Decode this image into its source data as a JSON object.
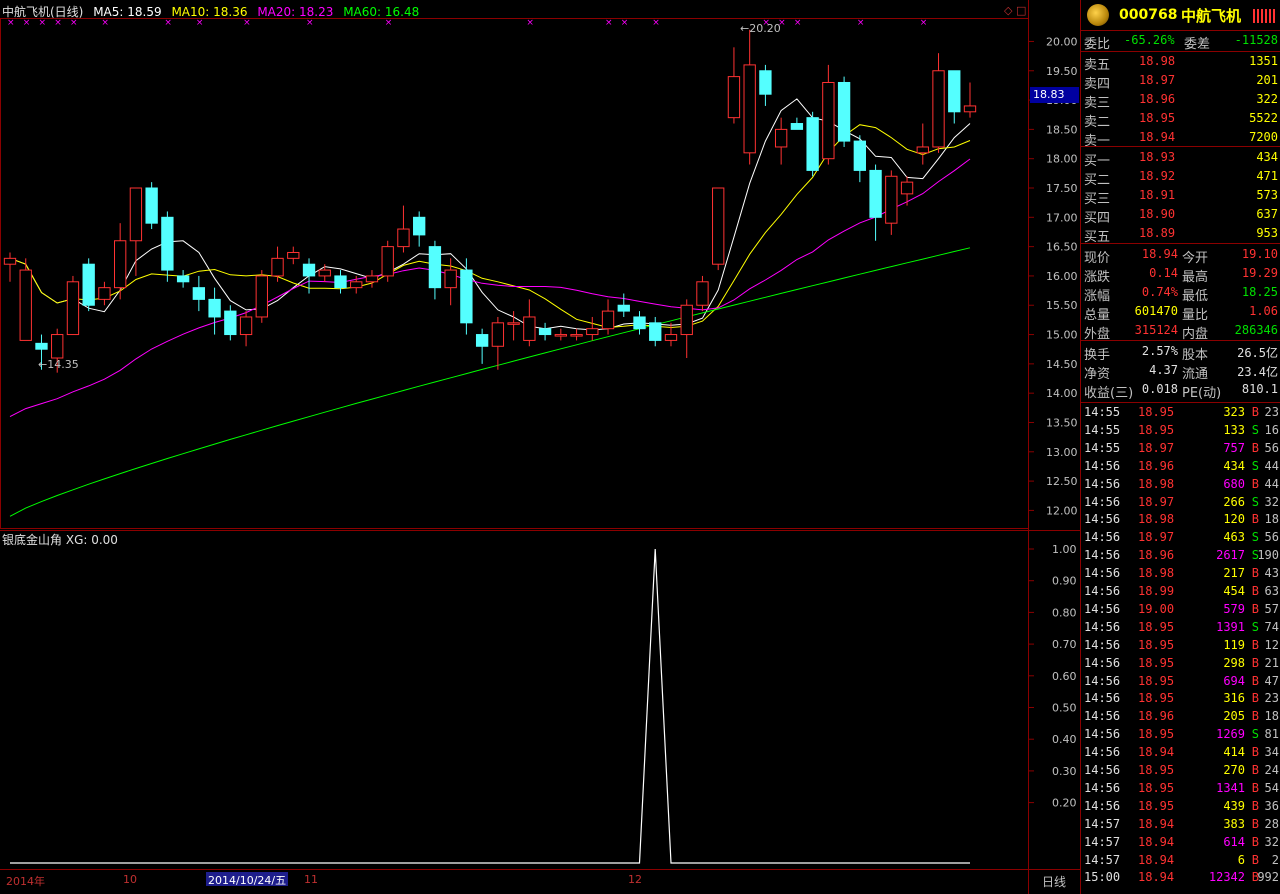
{
  "header": {
    "title": "中航飞机(日线)",
    "ma5": "MA5: 18.59",
    "ma10": "MA10: 18.36",
    "ma20": "MA20: 18.23",
    "ma60": "MA60: 16.48"
  },
  "price_axis": [
    "20.00",
    "19.50",
    "19.00",
    "18.50",
    "18.00",
    "17.50",
    "17.00",
    "16.50",
    "16.00",
    "15.50",
    "15.00",
    "14.50",
    "14.00",
    "13.50",
    "13.00",
    "12.50",
    "12.00"
  ],
  "current_price_tag": "18.83",
  "annotations": {
    "high": "20.20",
    "low": "14.35"
  },
  "indicator": {
    "title": "银底金山角",
    "xg": "XG: 0.00",
    "axis": [
      "1.00",
      "0.90",
      "0.80",
      "0.70",
      "0.60",
      "0.50",
      "0.40",
      "0.30",
      "0.20"
    ]
  },
  "time_axis": {
    "year": "2014年",
    "m10": "10",
    "cursor_date": "2014/10/24/五",
    "m11": "11",
    "m12": "12",
    "period": "日线"
  },
  "quote": {
    "code": "000768",
    "name": "中航飞机",
    "wb_label": "委比",
    "wb_value": "-65.26%",
    "wc_label": "委差",
    "wc_value": "-11528",
    "asks": [
      {
        "label": "卖五",
        "price": "18.98",
        "vol": "1351"
      },
      {
        "label": "卖四",
        "price": "18.97",
        "vol": "201"
      },
      {
        "label": "卖三",
        "price": "18.96",
        "vol": "322"
      },
      {
        "label": "卖二",
        "price": "18.95",
        "vol": "5522"
      },
      {
        "label": "卖一",
        "price": "18.94",
        "vol": "7200"
      }
    ],
    "bids": [
      {
        "label": "买一",
        "price": "18.93",
        "vol": "434"
      },
      {
        "label": "买二",
        "price": "18.92",
        "vol": "471"
      },
      {
        "label": "买三",
        "price": "18.91",
        "vol": "573"
      },
      {
        "label": "买四",
        "price": "18.90",
        "vol": "637"
      },
      {
        "label": "买五",
        "price": "18.89",
        "vol": "953"
      }
    ],
    "stats": [
      {
        "l1": "现价",
        "v1": "18.94",
        "l2": "今开",
        "v2": "19.10"
      },
      {
        "l1": "涨跌",
        "v1": "0.14",
        "l2": "最高",
        "v2": "19.29"
      },
      {
        "l1": "涨幅",
        "v1": "0.74%",
        "l2": "最低",
        "v2": "18.25"
      },
      {
        "l1": "总量",
        "v1": "601470",
        "l2": "量比",
        "v2": "1.06"
      },
      {
        "l1": "外盘",
        "v1": "315124",
        "l2": "内盘",
        "v2": "286346"
      }
    ],
    "fundamentals": [
      {
        "l1": "换手",
        "v1": "2.57%",
        "l2": "股本",
        "v2": "26.5亿"
      },
      {
        "l1": "净资",
        "v1": "4.37",
        "l2": "流通",
        "v2": "23.4亿"
      },
      {
        "l1": "收益(三)",
        "v1": "0.018",
        "l2": "PE(动)",
        "v2": "810.1"
      }
    ]
  },
  "ticks": [
    {
      "t": "14:55",
      "p": "18.95",
      "v": "323",
      "s": "B",
      "n": "23"
    },
    {
      "t": "14:55",
      "p": "18.95",
      "v": "133",
      "s": "S",
      "n": "16"
    },
    {
      "t": "14:55",
      "p": "18.97",
      "v": "757",
      "s": "B",
      "n": "56"
    },
    {
      "t": "14:56",
      "p": "18.96",
      "v": "434",
      "s": "S",
      "n": "44"
    },
    {
      "t": "14:56",
      "p": "18.98",
      "v": "680",
      "s": "B",
      "n": "44"
    },
    {
      "t": "14:56",
      "p": "18.97",
      "v": "266",
      "s": "S",
      "n": "32"
    },
    {
      "t": "14:56",
      "p": "18.98",
      "v": "120",
      "s": "B",
      "n": "18"
    },
    {
      "t": "14:56",
      "p": "18.97",
      "v": "463",
      "s": "S",
      "n": "56"
    },
    {
      "t": "14:56",
      "p": "18.96",
      "v": "2617",
      "s": "S",
      "n": "190"
    },
    {
      "t": "14:56",
      "p": "18.98",
      "v": "217",
      "s": "B",
      "n": "43"
    },
    {
      "t": "14:56",
      "p": "18.99",
      "v": "454",
      "s": "B",
      "n": "63"
    },
    {
      "t": "14:56",
      "p": "19.00",
      "v": "579",
      "s": "B",
      "n": "57"
    },
    {
      "t": "14:56",
      "p": "18.95",
      "v": "1391",
      "s": "S",
      "n": "74"
    },
    {
      "t": "14:56",
      "p": "18.95",
      "v": "119",
      "s": "B",
      "n": "12"
    },
    {
      "t": "14:56",
      "p": "18.95",
      "v": "298",
      "s": "B",
      "n": "21"
    },
    {
      "t": "14:56",
      "p": "18.95",
      "v": "694",
      "s": "B",
      "n": "47"
    },
    {
      "t": "14:56",
      "p": "18.95",
      "v": "316",
      "s": "B",
      "n": "23"
    },
    {
      "t": "14:56",
      "p": "18.96",
      "v": "205",
      "s": "B",
      "n": "18"
    },
    {
      "t": "14:56",
      "p": "18.95",
      "v": "1269",
      "s": "S",
      "n": "81"
    },
    {
      "t": "14:56",
      "p": "18.94",
      "v": "414",
      "s": "B",
      "n": "34"
    },
    {
      "t": "14:56",
      "p": "18.95",
      "v": "270",
      "s": "B",
      "n": "24"
    },
    {
      "t": "14:56",
      "p": "18.95",
      "v": "1341",
      "s": "B",
      "n": "54"
    },
    {
      "t": "14:56",
      "p": "18.95",
      "v": "439",
      "s": "B",
      "n": "36"
    },
    {
      "t": "14:57",
      "p": "18.94",
      "v": "383",
      "s": "B",
      "n": "28"
    },
    {
      "t": "14:57",
      "p": "18.94",
      "v": "614",
      "s": "B",
      "n": "32"
    },
    {
      "t": "14:57",
      "p": "18.94",
      "v": "6",
      "s": "B",
      "n": "2"
    },
    {
      "t": "15:00",
      "p": "18.94",
      "v": "12342",
      "s": "B",
      "n": "992"
    }
  ],
  "chart_data": {
    "type": "candlestick",
    "ylim": [
      11.7,
      20.4
    ],
    "candles": [
      [
        16.2,
        16.3,
        16.4,
        15.9
      ],
      [
        14.9,
        16.1,
        16.3,
        14.9
      ],
      [
        14.85,
        14.75,
        15.0,
        14.4
      ],
      [
        14.6,
        15.0,
        15.1,
        14.35
      ],
      [
        15.0,
        15.9,
        16.0,
        15.0
      ],
      [
        16.2,
        15.5,
        16.3,
        15.4
      ],
      [
        15.6,
        15.8,
        15.9,
        15.5
      ],
      [
        15.8,
        16.6,
        16.9,
        15.6
      ],
      [
        16.6,
        17.5,
        17.5,
        16.0
      ],
      [
        17.5,
        16.9,
        17.6,
        16.8
      ],
      [
        17.0,
        16.1,
        17.1,
        15.9
      ],
      [
        16.0,
        15.9,
        16.1,
        15.8
      ],
      [
        15.8,
        15.6,
        16.0,
        15.4
      ],
      [
        15.6,
        15.3,
        15.8,
        15.0
      ],
      [
        15.4,
        15.0,
        15.5,
        14.9
      ],
      [
        15.0,
        15.3,
        15.4,
        14.8
      ],
      [
        15.3,
        16.0,
        16.1,
        15.2
      ],
      [
        16.0,
        16.3,
        16.5,
        15.9
      ],
      [
        16.3,
        16.4,
        16.5,
        16.2
      ],
      [
        16.2,
        16.0,
        16.3,
        15.7
      ],
      [
        16.0,
        16.1,
        16.2,
        15.9
      ],
      [
        16.0,
        15.8,
        16.1,
        15.7
      ],
      [
        15.8,
        15.9,
        16.0,
        15.7
      ],
      [
        15.9,
        16.0,
        16.1,
        15.8
      ],
      [
        16.0,
        16.5,
        16.6,
        15.9
      ],
      [
        16.5,
        16.8,
        17.2,
        16.4
      ],
      [
        17.0,
        16.7,
        17.1,
        16.5
      ],
      [
        16.5,
        15.8,
        16.6,
        15.6
      ],
      [
        15.8,
        16.1,
        16.3,
        15.5
      ],
      [
        16.1,
        15.2,
        16.3,
        15.0
      ],
      [
        15.0,
        14.8,
        15.1,
        14.5
      ],
      [
        14.8,
        15.2,
        15.3,
        14.4
      ],
      [
        15.2,
        15.2,
        15.4,
        14.9
      ],
      [
        14.9,
        15.3,
        15.6,
        14.8
      ],
      [
        15.1,
        15.0,
        15.2,
        14.9
      ],
      [
        15.0,
        15.0,
        15.1,
        14.9
      ],
      [
        15.0,
        15.0,
        15.1,
        14.9
      ],
      [
        15.0,
        15.1,
        15.3,
        14.9
      ],
      [
        15.1,
        15.4,
        15.6,
        15.0
      ],
      [
        15.5,
        15.4,
        15.7,
        15.3
      ],
      [
        15.3,
        15.1,
        15.4,
        15.0
      ],
      [
        15.2,
        14.9,
        15.3,
        14.8
      ],
      [
        14.9,
        15.0,
        15.2,
        14.8
      ],
      [
        15.0,
        15.5,
        15.6,
        14.6
      ],
      [
        15.5,
        15.9,
        16.0,
        15.4
      ],
      [
        16.2,
        17.5,
        17.5,
        16.1
      ],
      [
        18.7,
        19.4,
        19.9,
        18.6
      ],
      [
        18.1,
        19.6,
        20.2,
        17.9
      ],
      [
        19.5,
        19.1,
        19.6,
        18.9
      ],
      [
        18.2,
        18.5,
        18.7,
        17.9
      ],
      [
        18.6,
        18.5,
        18.7,
        18.5
      ],
      [
        18.7,
        17.8,
        18.8,
        17.7
      ],
      [
        18.0,
        19.3,
        19.6,
        17.9
      ],
      [
        19.3,
        18.3,
        19.4,
        18.2
      ],
      [
        18.3,
        17.8,
        18.4,
        17.6
      ],
      [
        17.8,
        17.0,
        17.9,
        16.6
      ],
      [
        16.9,
        17.7,
        17.8,
        16.7
      ],
      [
        17.4,
        17.6,
        17.7,
        17.2
      ],
      [
        18.1,
        18.2,
        18.6,
        17.9
      ],
      [
        18.2,
        19.5,
        19.8,
        18.1
      ],
      [
        19.5,
        18.8,
        19.5,
        18.6
      ],
      [
        18.8,
        18.9,
        19.3,
        18.7
      ]
    ],
    "lines": [
      {
        "name": "MA5",
        "color": "#ffffff"
      },
      {
        "name": "MA10",
        "color": "#ffff00"
      },
      {
        "name": "MA20",
        "color": "#ff00ff"
      },
      {
        "name": "MA60",
        "color": "#00ff00"
      }
    ]
  },
  "colors": {
    "up": "#ff3232",
    "down": "#54ffff",
    "grid": "#8b0000",
    "axis_text": "#c0c0c0",
    "ma5": "#ffffff",
    "ma10": "#ffff00",
    "ma20": "#ff00ff",
    "ma60": "#00ff00"
  }
}
